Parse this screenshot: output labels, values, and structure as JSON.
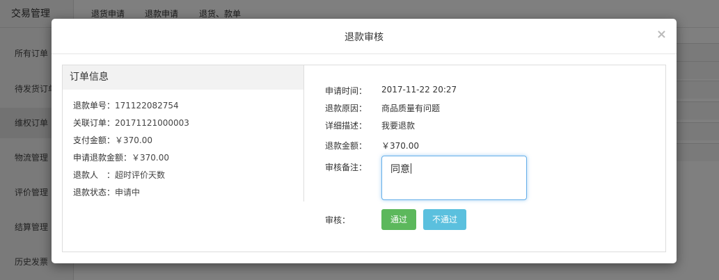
{
  "sidebar": {
    "title": "交易管理",
    "items": [
      {
        "label": "所有订单"
      },
      {
        "label": "待发货订单"
      },
      {
        "label": "维权订单"
      },
      {
        "label": "物流管理"
      },
      {
        "label": "评价管理"
      },
      {
        "label": "结算管理"
      },
      {
        "label": "历史发票"
      }
    ]
  },
  "topnav": {
    "tabs": [
      {
        "label": "退货申请"
      },
      {
        "label": "退款申请"
      },
      {
        "label": "退货、款单"
      }
    ]
  },
  "modal": {
    "title": "退款审核",
    "close_symbol": "×",
    "order_info": {
      "heading": "订单信息",
      "rows": [
        {
          "label": "退款单号：",
          "value": "171122082754"
        },
        {
          "label": "关联订单：",
          "value": "20171121000003"
        },
        {
          "label": "支付金额：",
          "value": "￥370.00"
        },
        {
          "label": "申请退款金额：",
          "value": "￥370.00"
        },
        {
          "label": "退款人　：",
          "value": "超时评价天数"
        },
        {
          "label": "退款状态：",
          "value": "申请中"
        }
      ]
    },
    "details": {
      "apply_time_label": "申请时间：",
      "apply_time": "2017-11-22 20:27",
      "reason_label": "退款原因：",
      "reason": "商品质量有问题",
      "description_label": "详细描述：",
      "description": "我要退款",
      "amount_label": "退款金额：",
      "amount": "￥370.00",
      "remark_label": "审核备注：",
      "remark_value": "同意",
      "review_label": "审核：",
      "pass_button": "通过",
      "reject_button": "不通过"
    }
  },
  "colors": {
    "pass_button": "#5cb85c",
    "reject_button": "#5bc0de",
    "focus_border": "#66afe9"
  }
}
